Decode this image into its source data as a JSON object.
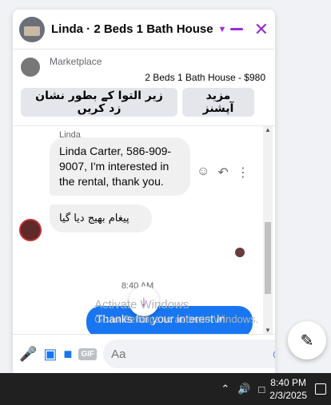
{
  "header": {
    "title": "Linda · 2 Beds 1 Bath House",
    "icons": [
      "chevron-down-icon",
      "minimize-icon",
      "close-icon"
    ],
    "accent_color": "#9b2bd6"
  },
  "marketplace": {
    "label": "Marketplace",
    "listing": "2 Beds 1 Bath House - $980",
    "button_mark_pending": "زیر التوا کے بطور نشان زد کریں",
    "button_more_options": "مزید آپشنز"
  },
  "messages": {
    "sender_name": "Linda",
    "incoming_1": "Linda Carter, 586-909-9007, I'm interested in the rental, thank you.",
    "incoming_2": "پیغام بھیج دیا گیا",
    "timestamp": "8:40 AM",
    "outgoing_1": "Thanks for your interest in"
  },
  "composer": {
    "placeholder": "Aa",
    "icons": [
      "microphone-icon",
      "photo-icon",
      "sticker-icon",
      "gif-icon",
      "emoji-icon",
      "thumbs-up-icon"
    ],
    "gif_label": "GIF"
  },
  "watermark": {
    "line1": "Activate Windows",
    "line2": "Go to Settings to activate Windows."
  },
  "taskbar": {
    "time": "8:40 PM",
    "date": "2/3/2025"
  },
  "colors": {
    "outgoing_bubble": "#1876f2",
    "incoming_bubble": "#f0f0f0"
  }
}
